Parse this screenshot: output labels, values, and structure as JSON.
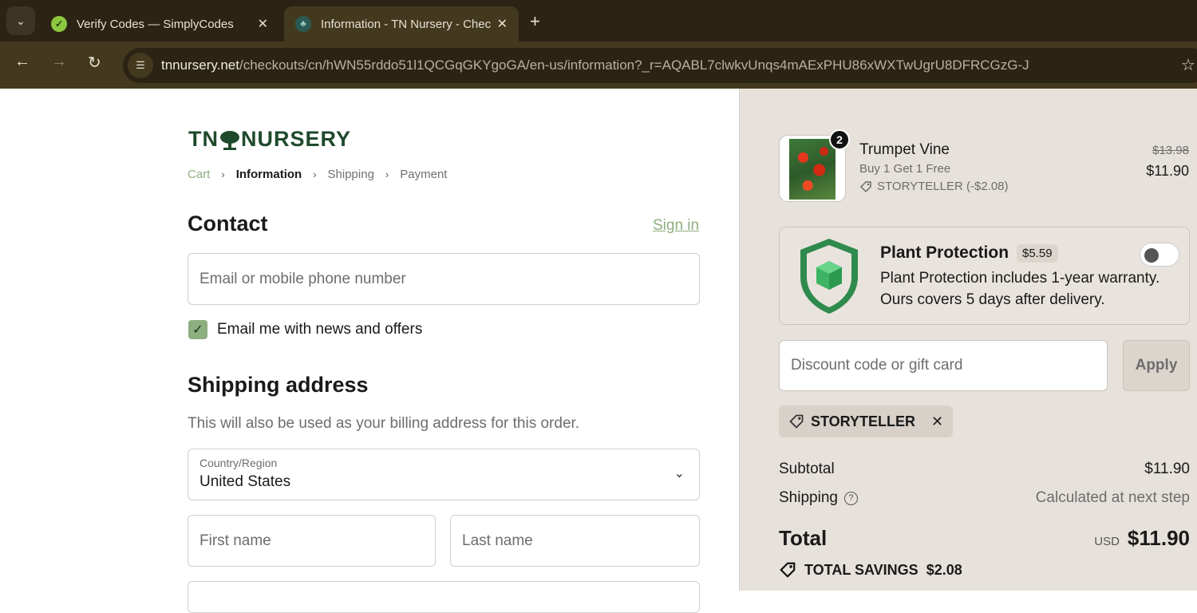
{
  "browser": {
    "tabs": [
      {
        "title": "Verify Codes — SimplyCodes",
        "close": "✕"
      },
      {
        "title": "Information - TN Nursery - Checkout",
        "close": "✕"
      }
    ],
    "new_tab": "+",
    "url_host": "tnnursery.net",
    "url_path": "/checkouts/cn/hWN55rddo51l1QCGqGKYgoGA/en-us/information?_r=AQABL7clwkvUnqs4mAExPHU86xWXTwUgrU8DFRCGzG-J"
  },
  "brand": {
    "left": "TN",
    "right": "NURSERY",
    "color": "#1f4a2c"
  },
  "breadcrumbs": {
    "cart": "Cart",
    "information": "Information",
    "shipping": "Shipping",
    "payment": "Payment",
    "sep": "›"
  },
  "contact": {
    "heading": "Contact",
    "sign_in": "Sign in",
    "email_placeholder": "Email or mobile phone number",
    "newsletter_label": "Email me with news and offers",
    "newsletter_checked": true
  },
  "shipping": {
    "heading": "Shipping address",
    "note": "This will also be used as your billing address for this order.",
    "country_label": "Country/Region",
    "country_value": "United States",
    "first_name_placeholder": "First name",
    "last_name_placeholder": "Last name"
  },
  "summary": {
    "item": {
      "quantity": "2",
      "name": "Trumpet Vine",
      "deal": "Buy 1 Get 1 Free",
      "code": "STORYTELLER (-$2.08)",
      "old_price": "$13.98",
      "price": "$11.90"
    },
    "protection": {
      "title": "Plant Protection",
      "price": "$5.59",
      "desc_line1": "Plant Protection includes 1-year warranty.",
      "desc_line2": "Ours covers 5 days after delivery.",
      "enabled": false
    },
    "discount_placeholder": "Discount code or gift card",
    "apply_label": "Apply",
    "applied_code": "STORYTELLER",
    "subtotal_label": "Subtotal",
    "subtotal_value": "$11.90",
    "shipping_label": "Shipping",
    "shipping_value": "Calculated at next step",
    "total_label": "Total",
    "total_currency": "USD",
    "total_value": "$11.90",
    "savings_label": "TOTAL SAVINGS",
    "savings_value": "$2.08"
  },
  "colors": {
    "accent": "#8dae7f",
    "summary_bg": "#e7e1db",
    "browser_bg": "#2b2414"
  }
}
